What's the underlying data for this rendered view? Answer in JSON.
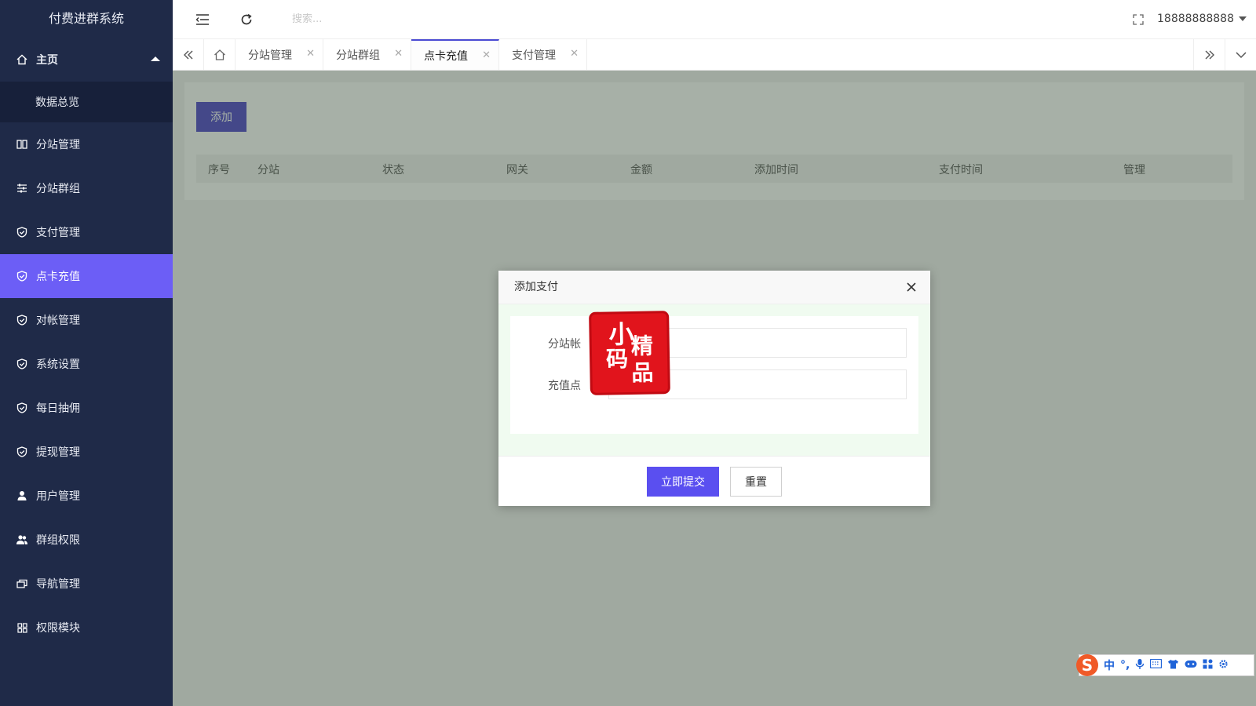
{
  "app": {
    "title": "付费进群系统"
  },
  "sidebar": {
    "home": {
      "label": "主页"
    },
    "home_sub": {
      "label": "数据总览"
    },
    "items": [
      {
        "label": "分站管理",
        "icon": "columns-icon"
      },
      {
        "label": "分站群组",
        "icon": "sliders-icon"
      },
      {
        "label": "支付管理",
        "icon": "shield-check-icon"
      },
      {
        "label": "点卡充值",
        "icon": "shield-check-icon",
        "active": true
      },
      {
        "label": "对帐管理",
        "icon": "shield-check-icon"
      },
      {
        "label": "系统设置",
        "icon": "shield-check-icon"
      },
      {
        "label": "每日抽佣",
        "icon": "shield-check-icon"
      },
      {
        "label": "提现管理",
        "icon": "shield-check-icon"
      },
      {
        "label": "用户管理",
        "icon": "user-icon"
      },
      {
        "label": "群组权限",
        "icon": "users-icon"
      },
      {
        "label": "导航管理",
        "icon": "cards-icon"
      },
      {
        "label": "权限模块",
        "icon": "grid-icon"
      }
    ]
  },
  "header": {
    "search_placeholder": "搜索...",
    "username": "18888888888"
  },
  "tabs": [
    {
      "label": "分站管理",
      "active": false
    },
    {
      "label": "分站群组",
      "active": false
    },
    {
      "label": "点卡充值",
      "active": true
    },
    {
      "label": "支付管理",
      "active": false
    }
  ],
  "page": {
    "add_label": "添加",
    "columns": [
      "序号",
      "分站",
      "状态",
      "网关",
      "金额",
      "添加时间",
      "支付时间",
      "管理"
    ]
  },
  "modal": {
    "title": "添加支付",
    "fields": [
      {
        "label": "分站帐",
        "value": ""
      },
      {
        "label": "充值点",
        "value": ""
      }
    ],
    "submit_label": "立即提交",
    "reset_label": "重置"
  },
  "stamp": {
    "text": "小码精品"
  },
  "ime": {
    "mode": "中",
    "punct": "°,"
  },
  "colors": {
    "sidebar_bg": "#1f2a48",
    "active_accent": "#6c5ef6",
    "primary_button": "#5a4ff0",
    "add_button": "#4b43c8"
  }
}
